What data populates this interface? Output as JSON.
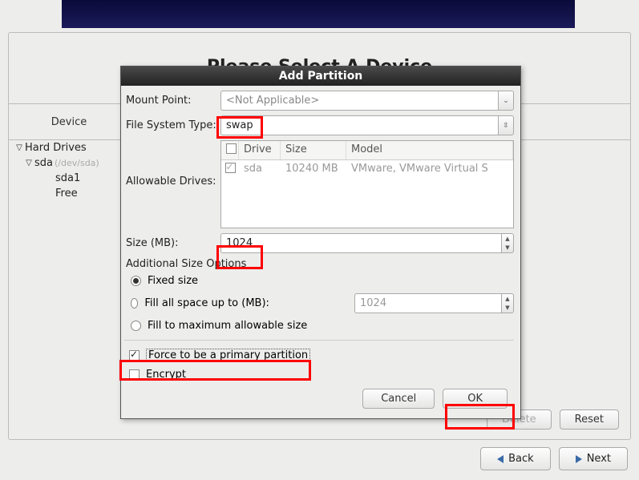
{
  "banner": {},
  "main": {
    "title": "Please Select A Device",
    "device_header": "Device",
    "tree": {
      "root": "Hard Drives",
      "disk": "sda",
      "disk_path": "(/dev/sda)",
      "part1": "sda1",
      "free": "Free"
    },
    "buttons": {
      "delete": "Delete",
      "reset": "Reset"
    }
  },
  "nav": {
    "back": "Back",
    "next": "Next"
  },
  "dialog": {
    "title": "Add Partition",
    "mount_point_label": "Mount Point:",
    "mount_point_value": "<Not Applicable>",
    "fs_type_label": "File System Type:",
    "fs_type_value": "swap",
    "allowable_label": "Allowable Drives:",
    "drives_head": {
      "drive": "Drive",
      "size": "Size",
      "model": "Model"
    },
    "drives_row": {
      "name": "sda",
      "size": "10240 MB",
      "model": "VMware, VMware Virtual S"
    },
    "size_label": "Size (MB):",
    "size_value": "1024",
    "addl_label": "Additional Size Options",
    "opt_fixed": "Fixed size",
    "opt_upto": "Fill all space up to (MB):",
    "opt_upto_value": "1024",
    "opt_max": "Fill to maximum allowable size",
    "force_primary": "Force to be a primary partition",
    "encrypt": "Encrypt",
    "cancel": "Cancel",
    "ok": "OK"
  }
}
